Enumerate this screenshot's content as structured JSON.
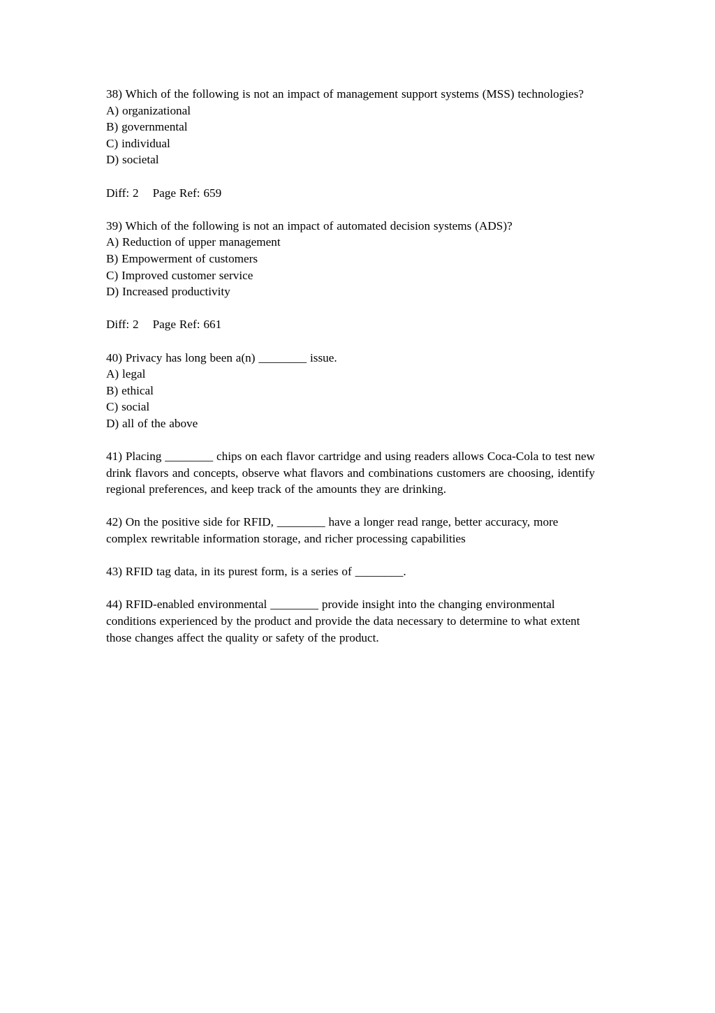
{
  "document": {
    "page_background": "#ffffff",
    "text_color": "#000000",
    "questions": [
      {
        "number": "38)",
        "stem": "Which of the following is not an impact of management support systems (MSS) technologies?",
        "options": [
          "A) organizational",
          "B) governmental",
          "C) individual",
          "D) societal"
        ],
        "meta": {
          "diff_label": "Diff:",
          "diff_value": "2",
          "page_ref_label": "Page Ref:",
          "page_ref_value": "659"
        }
      },
      {
        "number": "39)",
        "stem": "Which of the following is not an impact of automated decision systems (ADS)?",
        "options": [
          "A) Reduction of upper management",
          "B) Empowerment of customers",
          "C) Improved customer service",
          "D) Increased productivity"
        ],
        "meta": {
          "diff_label": "Diff:",
          "diff_value": "2",
          "page_ref_label": "Page Ref:",
          "page_ref_value": "661"
        }
      },
      {
        "number": "40)",
        "stem": "Privacy has long been a(n) ________ issue.",
        "options": [
          "A) legal",
          "B) ethical",
          "C) social",
          "D) all of the above"
        ],
        "meta": null
      },
      {
        "number": "41)",
        "stem": "Placing ________ chips on each flavor cartridge and using readers allows Coca-Cola to test new drink flavors and concepts, observe what flavors and combinations customers are choosing, identify regional preferences, and keep track of the amounts they are drinking.",
        "options": [],
        "meta": null
      },
      {
        "number": "42)",
        "stem": "On the positive side for RFID, ________ have a longer read range, better accuracy, more complex rewritable information storage, and richer processing capabilities",
        "options": [],
        "meta": null
      },
      {
        "number": "43)",
        "stem": "RFID tag data, in its purest form, is a series of ________.",
        "options": [],
        "meta": null
      },
      {
        "number": "44)",
        "stem": "RFID-enabled environmental ________ provide insight into the changing environmental conditions experienced by the product and provide the data necessary to determine to what extent those changes affect the quality or safety of the product.",
        "options": [],
        "meta": null
      }
    ]
  }
}
